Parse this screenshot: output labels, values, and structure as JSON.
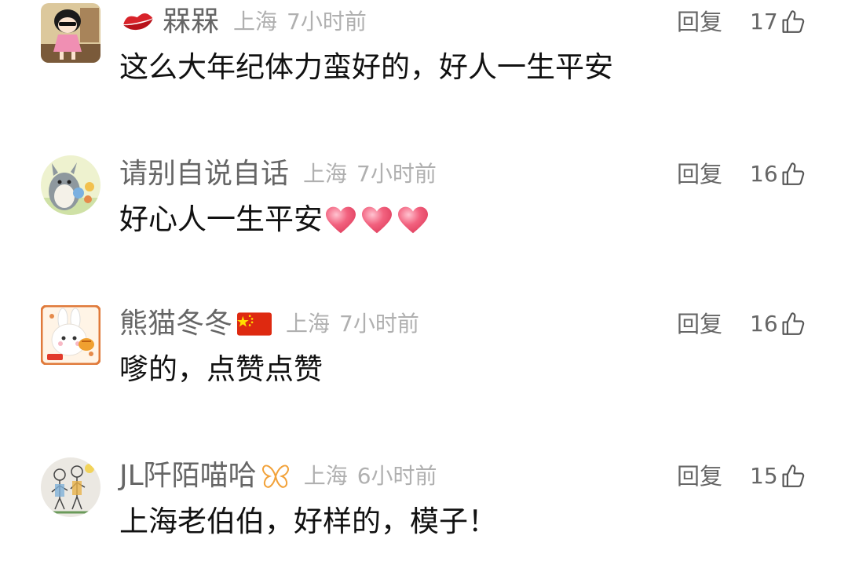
{
  "colors": {
    "background": "#ffffff",
    "username": "#666666",
    "meta": "#b0b0b0",
    "text": "#111111",
    "action": "#666666",
    "heart": "#f2627f",
    "lips": "#d8232a",
    "flag_red": "#de2910",
    "flag_star": "#ffde00",
    "butterfly": "#f2a23a"
  },
  "comments": [
    {
      "user": {
        "name": "槑槑",
        "badge_icon": "lips-icon",
        "avatar": "cartoon-girl-avatar"
      },
      "location": "上海",
      "time": "7小时前",
      "text": "这么大年纪体力蛮好的，好人一生平安",
      "reply_label": "回复",
      "likes": "17",
      "like_icon": "thumbs-up-icon"
    },
    {
      "user": {
        "name": "请别自说自话",
        "badge_icon": null,
        "avatar": "totoro-avatar"
      },
      "location": "上海",
      "time": "7小时前",
      "text": "好心人一生平安",
      "emoji": [
        "heart-icon",
        "heart-icon",
        "heart-icon"
      ],
      "reply_label": "回复",
      "likes": "16",
      "like_icon": "thumbs-up-icon"
    },
    {
      "user": {
        "name": "熊猫冬冬",
        "badge_icon": "china-flag-icon",
        "avatar": "bunny-avatar"
      },
      "location": "上海",
      "time": "7小时前",
      "text": "嗲的，点赞点赞",
      "reply_label": "回复",
      "likes": "16",
      "like_icon": "thumbs-up-icon"
    },
    {
      "user": {
        "name": "JL阡陌喵哈",
        "badge_icon": "butterfly-icon",
        "avatar": "sketch-avatar"
      },
      "location": "上海",
      "time": "6小时前",
      "text": "上海老伯伯，好样的，模子！",
      "reply_label": "回复",
      "likes": "15",
      "like_icon": "thumbs-up-icon"
    }
  ]
}
